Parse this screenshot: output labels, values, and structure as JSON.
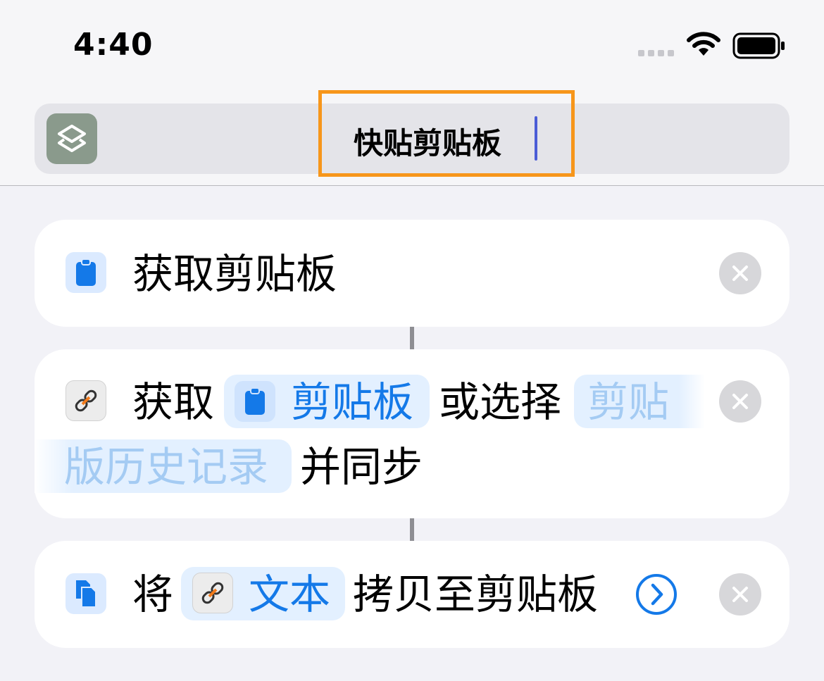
{
  "status_bar": {
    "time": "4:40"
  },
  "title_bar": {
    "title": "快贴剪贴板"
  },
  "actions": [
    {
      "label": "获取剪贴板"
    },
    {
      "prefix": "获取",
      "token1": "剪贴板",
      "middle": "或选择",
      "token2_line1": "剪贴",
      "token2_line2": "版历史记录",
      "suffix": "并同步"
    },
    {
      "prefix": "将",
      "token": "文本",
      "suffix": "拷贝至剪贴板"
    }
  ],
  "colors": {
    "accent": "#1479e8",
    "highlight": "#f7961b",
    "caret": "#4a5cd6"
  }
}
